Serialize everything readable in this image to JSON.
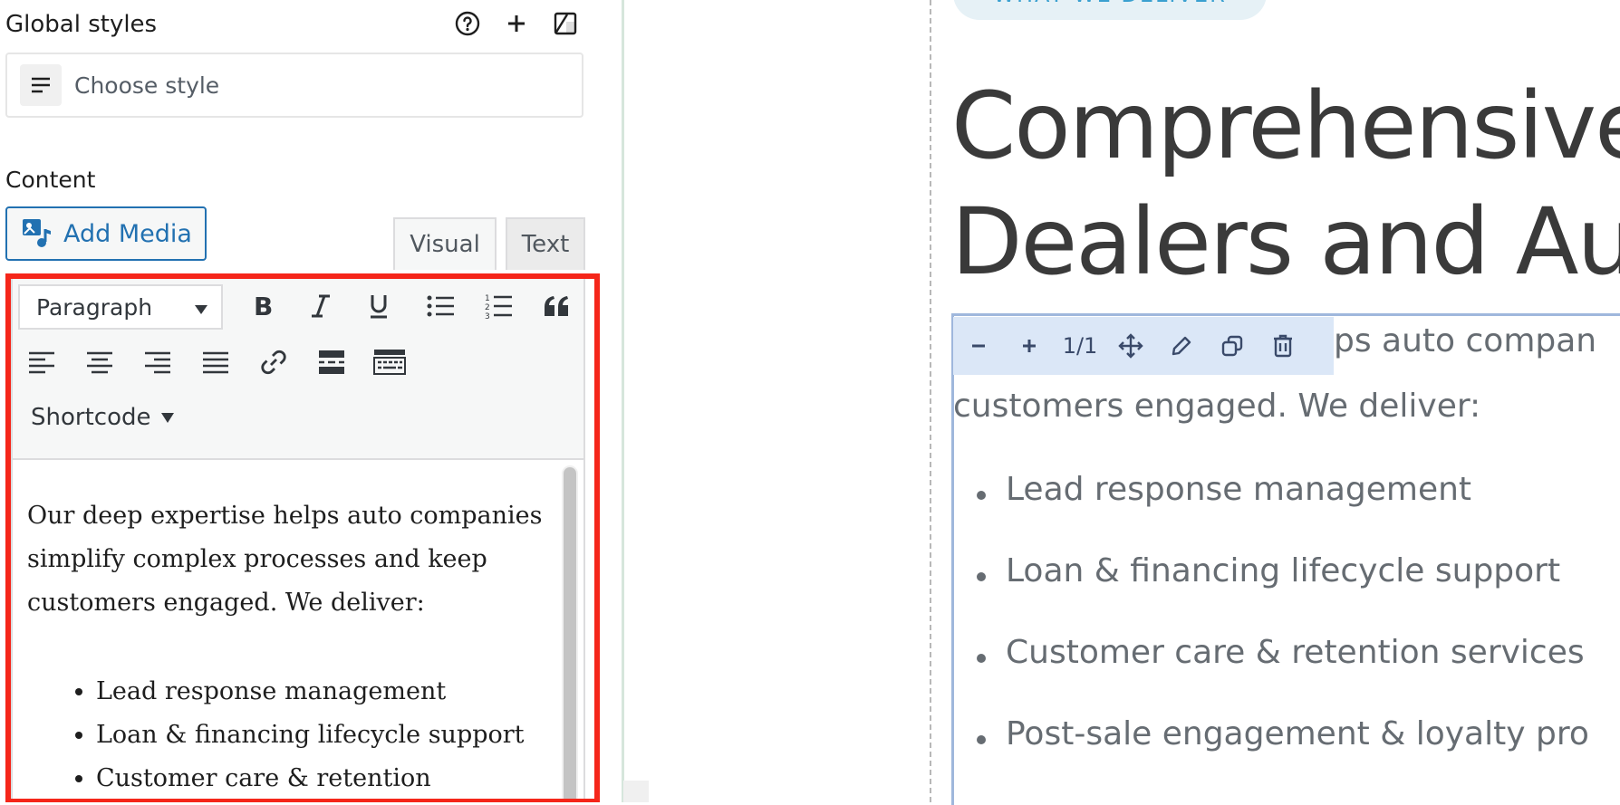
{
  "global_styles": {
    "title": "Global styles",
    "icons": [
      "help-icon",
      "plus-icon",
      "style-book-icon"
    ],
    "choose_style_placeholder": "Choose style"
  },
  "content": {
    "label": "Content",
    "add_media_label": "Add Media",
    "tabs": [
      {
        "label": "Visual",
        "active": true
      },
      {
        "label": "Text",
        "active": false
      }
    ]
  },
  "editor_toolbar": {
    "format_select_value": "Paragraph",
    "row1_icons": [
      "bold-icon",
      "italic-icon",
      "underline-icon",
      "bulleted-list-icon",
      "numbered-list-icon",
      "blockquote-icon"
    ],
    "row2_icons": [
      "align-left-icon",
      "align-center-icon",
      "align-right-icon",
      "align-justify-icon",
      "link-icon",
      "read-more-icon",
      "toolbar-toggle-icon"
    ],
    "shortcode_label": "Shortcode"
  },
  "editor_body": {
    "paragraph": "Our deep expertise helps auto companies simplify complex processes and keep customers engaged. We deliver:",
    "list_items": [
      " Lead response management",
      "Loan & financing lifecycle support",
      "Customer care & retention"
    ]
  },
  "preview": {
    "pill_label": "WHAT WE DELIVER",
    "heading_line1": "Comprehensive",
    "heading_line2": "Dealers and Aut",
    "block_toolbar": {
      "count": "1/1",
      "icons": [
        "minus-icon",
        "plus-icon",
        "move-icon",
        "edit-icon",
        "duplicate-icon",
        "delete-icon"
      ]
    },
    "para_visible_start": "ps auto compan",
    "para_line2": "customers engaged. We deliver:",
    "list_items": [
      " Lead response management",
      "Loan & financing lifecycle support",
      "Customer care & retention services",
      "Post-sale engagement & loyalty pro"
    ]
  },
  "colors": {
    "accent": "#2271b1",
    "highlight": "#f5261a",
    "block_toolbar_bg": "#dbe7f7",
    "pill_bg": "#e6f1f6"
  }
}
